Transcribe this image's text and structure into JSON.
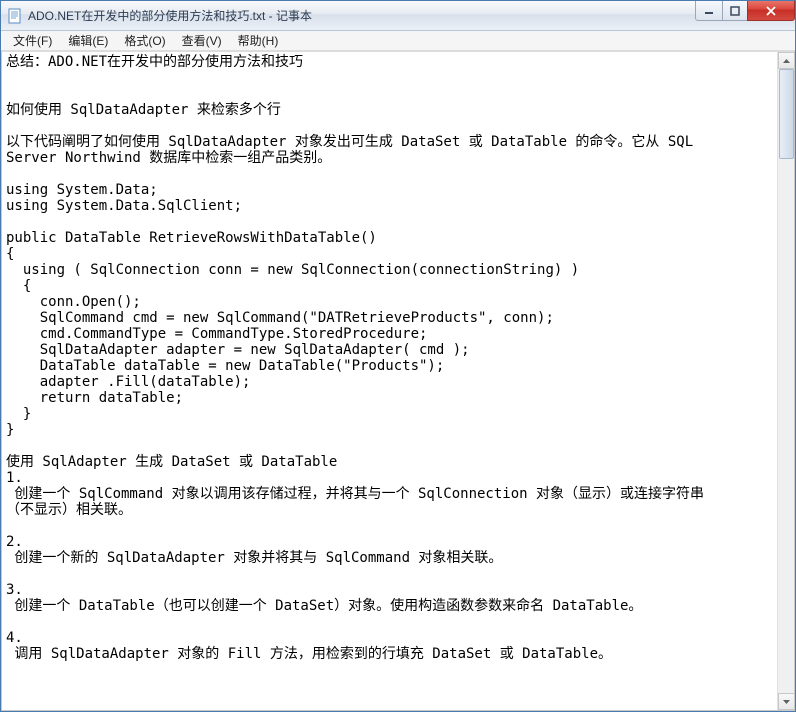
{
  "window": {
    "title": "ADO.NET在开发中的部分使用方法和技巧.txt - 记事本"
  },
  "menu": {
    "file": "文件(F)",
    "edit": "编辑(E)",
    "format": "格式(O)",
    "view": "查看(V)",
    "help": "帮助(H)"
  },
  "body": "总结：ADO.NET在开发中的部分使用方法和技巧\n\n\n如何使用 SqlDataAdapter 来检索多个行\n\n以下代码阐明了如何使用 SqlDataAdapter 对象发出可生成 DataSet 或 DataTable 的命令。它从 SQL\nServer Northwind 数据库中检索一组产品类别。\n\nusing System.Data;\nusing System.Data.SqlClient;\n\npublic DataTable RetrieveRowsWithDataTable()\n{\n  using ( SqlConnection conn = new SqlConnection(connectionString) )\n  {\n    conn.Open();\n    SqlCommand cmd = new SqlCommand(\"DATRetrieveProducts\", conn);\n    cmd.CommandType = CommandType.StoredProcedure;\n    SqlDataAdapter adapter = new SqlDataAdapter( cmd );\n    DataTable dataTable = new DataTable(\"Products\");\n    adapter .Fill(dataTable);\n    return dataTable;\n  }\n}\n\n使用 SqlAdapter 生成 DataSet 或 DataTable\n1.\n 创建一个 SqlCommand 对象以调用该存储过程，并将其与一个 SqlConnection 对象（显示）或连接字符串\n（不显示）相关联。\n\n2.\n 创建一个新的 SqlDataAdapter 对象并将其与 SqlCommand 对象相关联。\n\n3.\n 创建一个 DataTable（也可以创建一个 DataSet）对象。使用构造函数参数来命名 DataTable。\n\n4.\n 调用 SqlDataAdapter 对象的 Fill 方法，用检索到的行填充 DataSet 或 DataTable。\n"
}
